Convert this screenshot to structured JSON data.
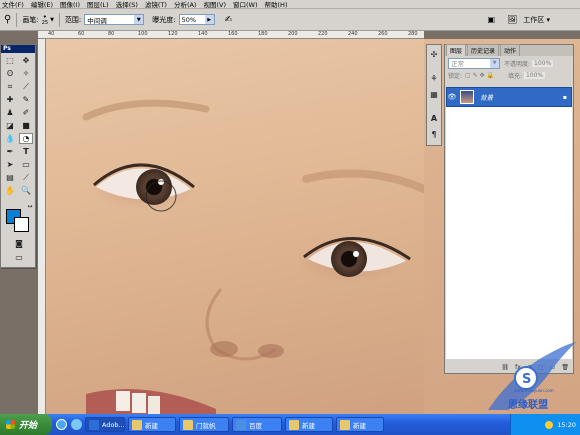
{
  "menu": [
    "文件(F)",
    "编辑(E)",
    "图像(I)",
    "图层(L)",
    "选择(S)",
    "滤镜(T)",
    "分析(A)",
    "视图(V)",
    "窗口(W)",
    "帮助(H)"
  ],
  "options": {
    "brush_label": "画笔:",
    "brush_size": "25",
    "range_label": "范围:",
    "range_value": "中间调",
    "exposure_label": "曝光度:",
    "exposure_value": "50%",
    "workspace_label": "工作区 ▾"
  },
  "ruler": {
    "numbers": [
      "40",
      "60",
      "80",
      "100",
      "120",
      "140",
      "160",
      "180",
      "200",
      "220",
      "240",
      "260",
      "280"
    ]
  },
  "toolbox": {
    "title": "Ps"
  },
  "layers_panel": {
    "tabs": [
      "图层",
      "历史记录",
      "动作"
    ],
    "blend_mode": "正常",
    "opacity_label": "不透明度:",
    "opacity_value": "100%",
    "lock_label": "锁定:",
    "fill_label": "填充:",
    "fill_value": "100%",
    "layer_name": "背景",
    "footer_icons": [
      "fx",
      "◑",
      "□",
      "▭",
      "🗑"
    ]
  },
  "taskbar": {
    "start_label": "开始",
    "buttons": [
      "Adob...",
      "新建",
      "门就帆",
      "百度",
      "新建",
      "新建"
    ],
    "clock": "15:20"
  },
  "watermark": {
    "text": "思缘联盟",
    "sub": "www.missyuan.com"
  }
}
